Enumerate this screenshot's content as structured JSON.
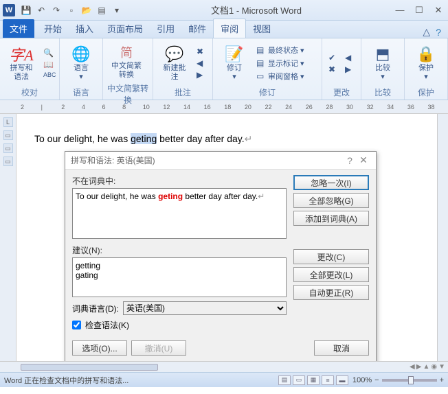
{
  "title": "文档1 - Microsoft Word",
  "tabs": {
    "file": "文件",
    "home": "开始",
    "insert": "插入",
    "layout": "页面布局",
    "ref": "引用",
    "mail": "邮件",
    "review": "审阅",
    "view": "视图"
  },
  "ribbon": {
    "spellcheck": "拼写和语法",
    "language": "语言",
    "cnconvert": "中文简繁\n转换",
    "newcomment": "新建批注",
    "track": "修订",
    "finalstate": "最终状态",
    "showtags": "显示标记",
    "reviewpane": "审阅窗格",
    "compare": "比较",
    "protect": "保护",
    "grp_proof": "校对",
    "grp_lang": "语言",
    "grp_cn": "中文简繁转换",
    "grp_comment": "批注",
    "grp_track": "修订",
    "grp_change": "更改",
    "grp_compare": "比较",
    "grp_protect": "保护"
  },
  "doc": {
    "pre": "To our delight, he was ",
    "err": "geting",
    "post": " better day after day.",
    "para": "↵"
  },
  "dialog": {
    "title": "拼写和语法: 英语(美国)",
    "notfound_label": "不在词典中:",
    "sentence_pre": "To our delight, he was ",
    "sentence_err": "geting",
    "sentence_post": " better day after day.",
    "sentence_para": "↵",
    "suggest_label": "建议(N):",
    "suggestions": [
      "getting",
      "gating"
    ],
    "ignore_once": "忽略一次(I)",
    "ignore_all": "全部忽略(G)",
    "add_dict": "添加到词典(A)",
    "change": "更改(C)",
    "change_all": "全部更改(L)",
    "autocorrect": "自动更正(R)",
    "dict_lang_label": "词典语言(D):",
    "dict_lang_value": "英语(美国)",
    "check_grammar": "检查语法(K)",
    "options": "选项(O)...",
    "undo": "撤消(U)",
    "cancel": "取消"
  },
  "status": {
    "text": "Word 正在检查文档中的拼写和语法...",
    "zoom": "100%"
  }
}
